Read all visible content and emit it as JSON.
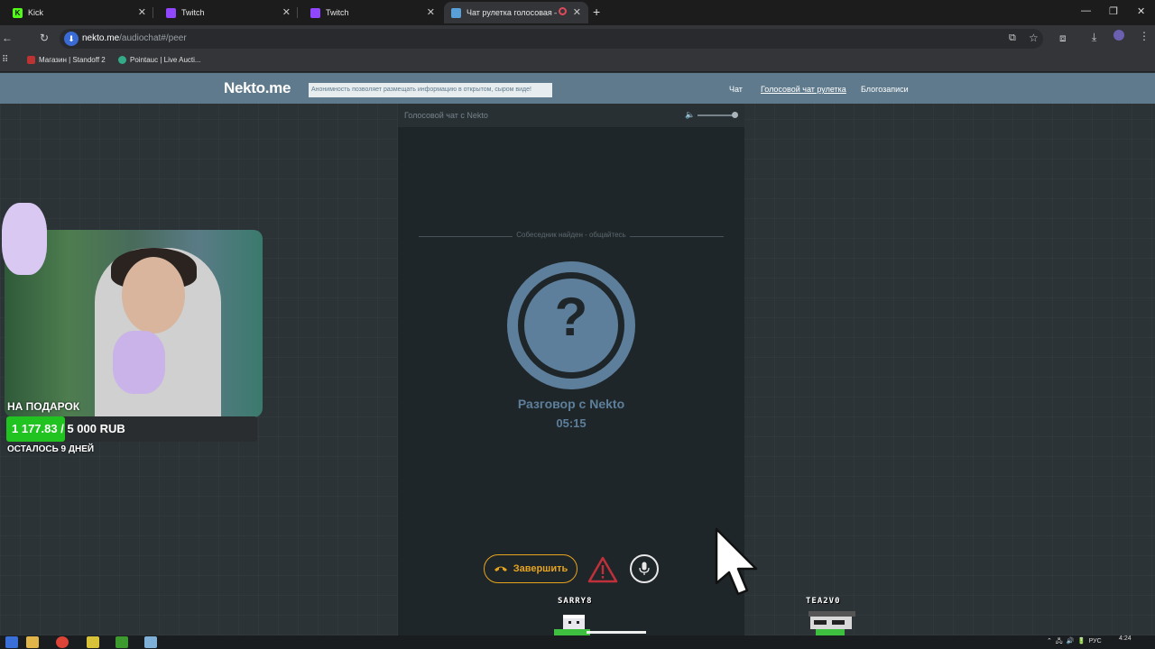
{
  "browser": {
    "tabs": [
      {
        "label": "Kick",
        "favicon_color": "#53fc18",
        "icon": "kick-icon"
      },
      {
        "label": "Twitch",
        "favicon_color": "#9146ff",
        "icon": "twitch-icon"
      },
      {
        "label": "Twitch",
        "favicon_color": "#9146ff",
        "icon": "twitch-icon"
      },
      {
        "label": "Чат рулетка голосовая — Н",
        "favicon_color": "#5aa0d8",
        "icon": "nekto-icon"
      }
    ],
    "url_host": "nekto.me",
    "url_path": "/audiochat#/peer",
    "bookmarks": [
      {
        "label": "Магазин | Standoff 2"
      },
      {
        "label": "Pointauc | Live Aucti..."
      }
    ]
  },
  "site": {
    "logo": "Nekto.me",
    "notice": "Анонимность позволяет размещать информацию в открытом, сыром виде!",
    "nav": [
      "Чат",
      "Голосовой чат рулетка",
      "Блогозаписи"
    ]
  },
  "panel": {
    "title": "Голосовой чат с Nekto",
    "status": "Собеседник найден - общайтесь",
    "conversation_title": "Разговор с Nekto",
    "timer": "05:15",
    "end_button": "Завершить"
  },
  "overlay": {
    "gift_label": "НА ПОДАРОК",
    "gift_amount": "1 177.83 / 5 000 RUB",
    "gift_progress": 0.235,
    "gift_remaining": "ОСТАЛОСЬ 9 ДНЕЙ",
    "characters": [
      "SARRY8",
      "TEA2V0"
    ]
  },
  "taskbar": {
    "language": "РУС",
    "time": "4:24"
  },
  "colors": {
    "header": "#5e7a8c",
    "accent_orange": "#e6a41e",
    "avatar_blue": "#5d7f9b",
    "progress_green": "#21c321"
  }
}
